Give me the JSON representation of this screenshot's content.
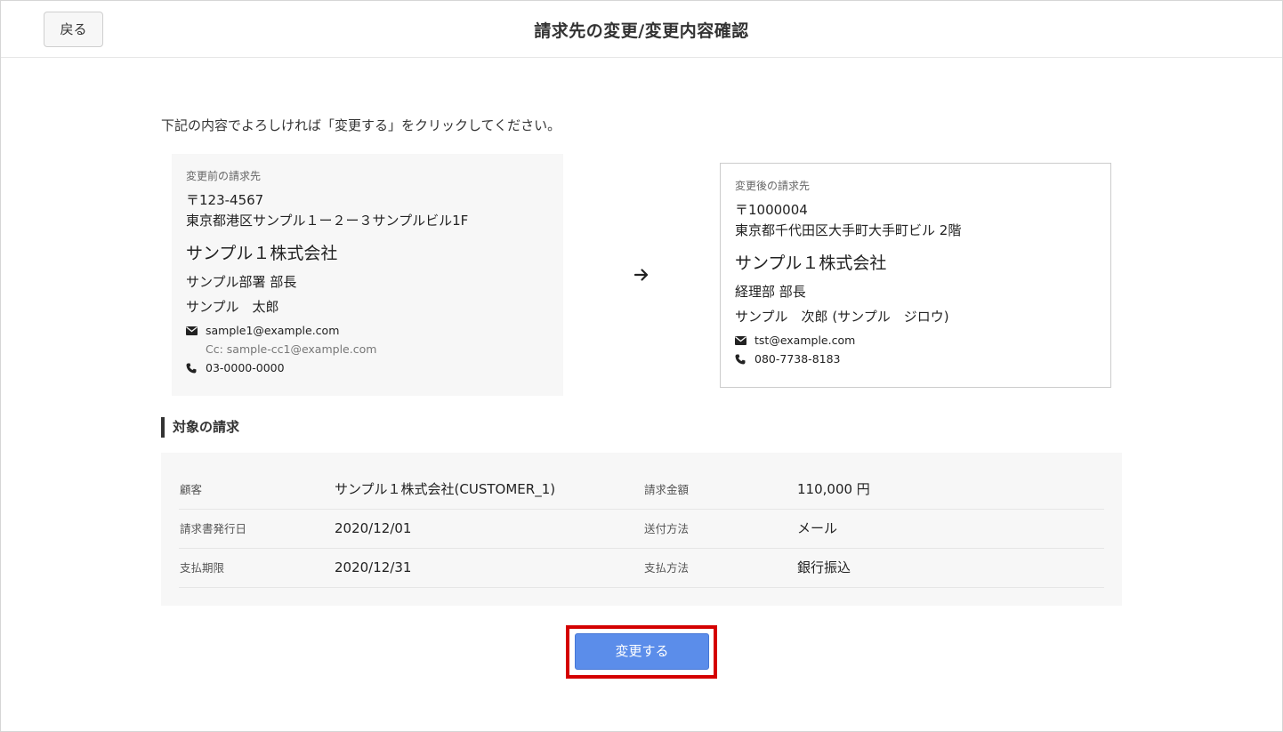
{
  "header": {
    "back_label": "戻る",
    "title": "請求先の変更/変更内容確認"
  },
  "instruction": "下記の内容でよろしければ「変更する」をクリックしてください。",
  "before": {
    "label": "変更前の請求先",
    "postal": "〒123-4567",
    "address": "東京都港区サンプル１ー２ー３サンプルビル1F",
    "company": "サンプル１株式会社",
    "dept": "サンプル部署 部長",
    "person": "サンプル　太郎",
    "email": "sample1@example.com",
    "cc": "Cc: sample-cc1@example.com",
    "phone": "03-0000-0000"
  },
  "after": {
    "label": "変更後の請求先",
    "postal": "〒1000004",
    "address": "東京都千代田区大手町大手町ビル 2階",
    "company": "サンプル１株式会社",
    "dept": "経理部 部長",
    "person": "サンプル　次郎 (サンプル　ジロウ)",
    "email": "tst@example.com",
    "phone": "080-7738-8183"
  },
  "section_title": "対象の請求",
  "details": {
    "rows": [
      {
        "label1": "顧客",
        "value1": "サンプル１株式会社(CUSTOMER_1)",
        "label2": "請求金額",
        "value2": "110,000 円"
      },
      {
        "label1": "請求書発行日",
        "value1": "2020/12/01",
        "label2": "送付方法",
        "value2": "メール"
      },
      {
        "label1": "支払期限",
        "value1": "2020/12/31",
        "label2": "支払方法",
        "value2": "銀行振込"
      }
    ]
  },
  "submit_label": "変更する",
  "icons": {
    "email": "envelope-icon",
    "phone": "phone-icon",
    "arrow": "arrow-right-icon"
  },
  "colors": {
    "primary": "#5b8dea",
    "highlight": "#d40000"
  }
}
